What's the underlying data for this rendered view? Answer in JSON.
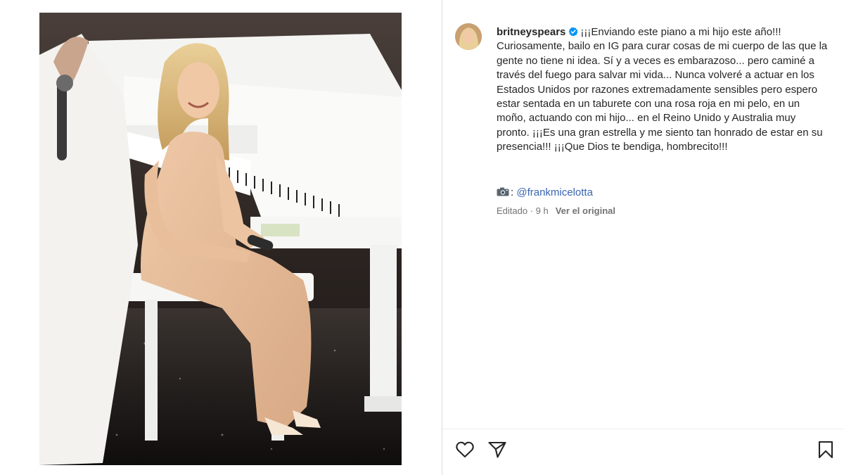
{
  "post": {
    "username": "britneyspears",
    "caption": "¡¡¡Enviando este piano a mi hijo este año!!! Curiosamente, bailo en IG para curar cosas de mi cuerpo de las que la gente no tiene ni idea. Sí y a veces es embarazoso... pero caminé a través del fuego para salvar mi vida... Nunca volveré a actuar en los Estados Unidos por razones extremadamente sensibles pero espero estar sentada en un taburete con una rosa roja en mi pelo, en un moño, actuando con mi hijo... en el Reino Unido y Australia muy pronto. ¡¡¡Es una gran estrella y me siento tan honrado de estar en su presencia!!! ¡¡¡Que Dios te bendiga, hombrecito!!!",
    "credit_separator": ":",
    "credit_mention": "@frankmicelotta",
    "edited_label": "Editado · 9 h",
    "see_original_label": "Ver el original"
  },
  "icons": {
    "verified": "verified-badge-icon",
    "camera": "camera-icon",
    "like": "heart-icon",
    "share": "paper-plane-icon",
    "save": "bookmark-icon"
  },
  "colors": {
    "text": "#262626",
    "secondary": "#737373",
    "link": "#3a66b3",
    "verified": "#0095f6",
    "divider": "#dbdbdb"
  }
}
